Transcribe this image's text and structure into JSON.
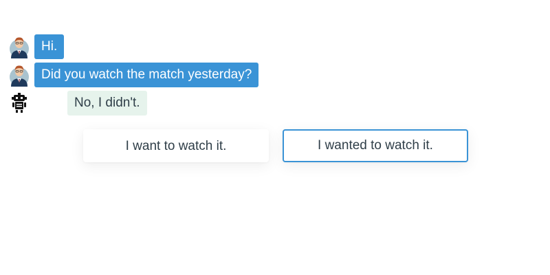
{
  "messages": [
    {
      "role": "user",
      "text": "Hi.",
      "avatar_icon": "man-avatar-icon"
    },
    {
      "role": "user",
      "text": "Did you watch the match yesterday?",
      "avatar_icon": "man-avatar-icon"
    },
    {
      "role": "bot",
      "text": "No, I didn't.",
      "avatar_icon": "robot-icon"
    }
  ],
  "choices": [
    {
      "label": "I want to watch it."
    },
    {
      "label": "I wanted to watch it.",
      "selected": true
    }
  ],
  "colors": {
    "user_bubble": "#3a93d6",
    "bot_bubble": "#e6f3ec",
    "selected_border": "#3a93d6",
    "text": "#2f3e48"
  }
}
